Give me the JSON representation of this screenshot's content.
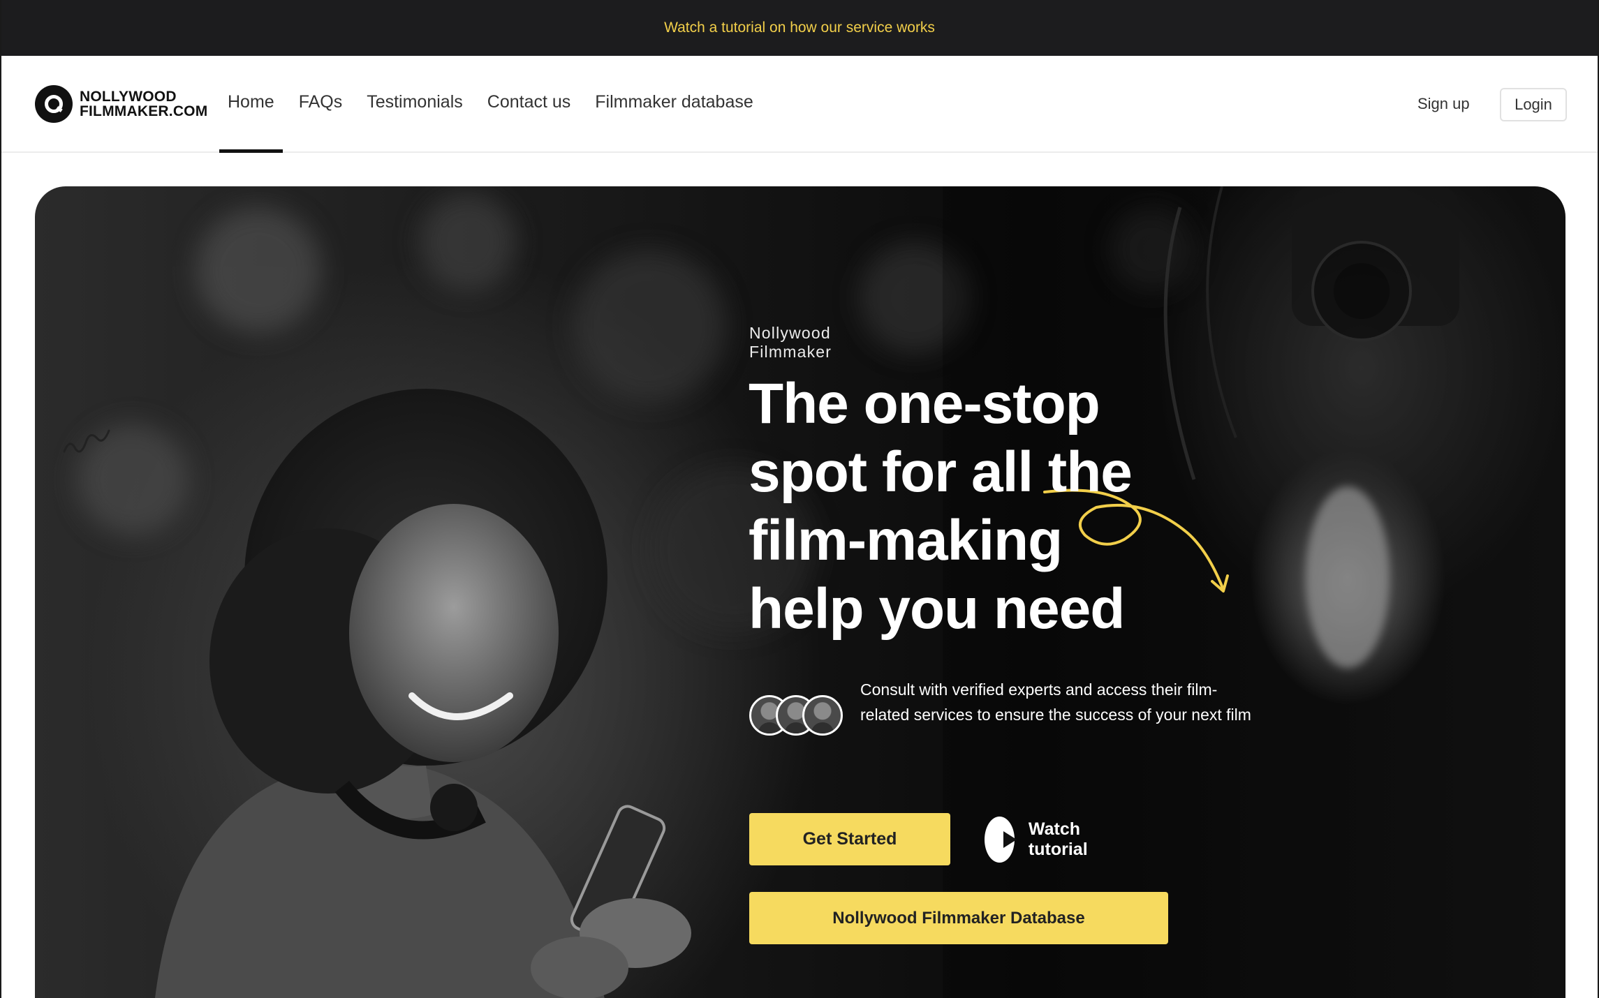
{
  "banner": {
    "text": "Watch a tutorial on how our service works"
  },
  "logo": {
    "line1": "NOLLYWOOD",
    "line2": "FILMMAKER.COM"
  },
  "nav": {
    "items": [
      {
        "label": "Home",
        "active": true
      },
      {
        "label": "FAQs",
        "active": false
      },
      {
        "label": "Testimonials",
        "active": false
      },
      {
        "label": "Contact us",
        "active": false
      },
      {
        "label": "Filmmaker database",
        "active": false
      }
    ]
  },
  "auth": {
    "signup": "Sign up",
    "login": "Login"
  },
  "hero": {
    "eyebrow": "Nollywood Filmmaker",
    "headline": "The one-stop spot for all the film-making help you need",
    "subtext": "Consult with verified experts and access their film-related services to ensure the success of your next film",
    "cta_primary": "Get Started",
    "cta_watch": "Watch tutorial",
    "cta_database": "Nollywood Filmmaker Database"
  },
  "colors": {
    "accent_yellow": "#f6da5f",
    "banner_text": "#f2cf4a",
    "banner_bg": "#1c1c1e",
    "doodle": "#f2cf4a"
  },
  "icons": {
    "logo": "logo-mark-icon",
    "play": "play-icon",
    "arrow": "curly-arrow-doodle",
    "scribble": "scribble-doodle"
  }
}
